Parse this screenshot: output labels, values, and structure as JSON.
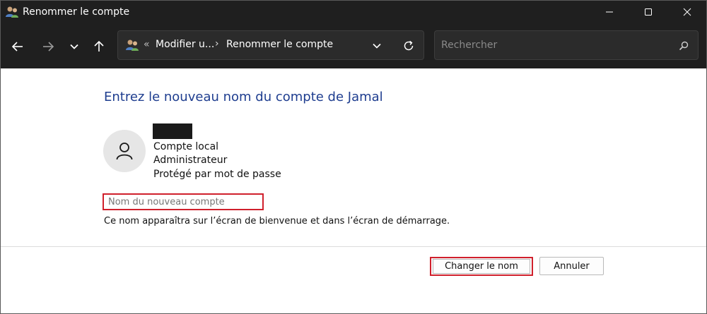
{
  "window": {
    "title": "Renommer le compte"
  },
  "navigation": {
    "breadcrumb_overflow": "«",
    "crumbs": [
      "Modifier u...",
      "Renommer le compte"
    ],
    "separator": "›"
  },
  "search": {
    "placeholder": "Rechercher"
  },
  "main": {
    "heading": "Entrez le nouveau nom du compte de Jamal",
    "account": {
      "type": "Compte local",
      "role": "Administrateur",
      "protection": "Protégé par mot de passe"
    },
    "name_field": {
      "placeholder": "Nom du nouveau compte",
      "value": ""
    },
    "hint": "Ce nom apparaîtra sur l’écran de bienvenue et dans l’écran de démarrage."
  },
  "buttons": {
    "change": "Changer le nom",
    "cancel": "Annuler"
  },
  "colors": {
    "titlebar_bg": "#1f1f1f",
    "heading": "#1e3d8f",
    "highlight": "#d0202c"
  },
  "icons": {
    "app": "users-icon",
    "back": "arrow-left-icon",
    "forward": "arrow-right-icon",
    "recent": "chevron-down-icon",
    "up": "arrow-up-icon",
    "refresh": "refresh-icon",
    "search": "search-icon",
    "avatar": "user-icon"
  }
}
